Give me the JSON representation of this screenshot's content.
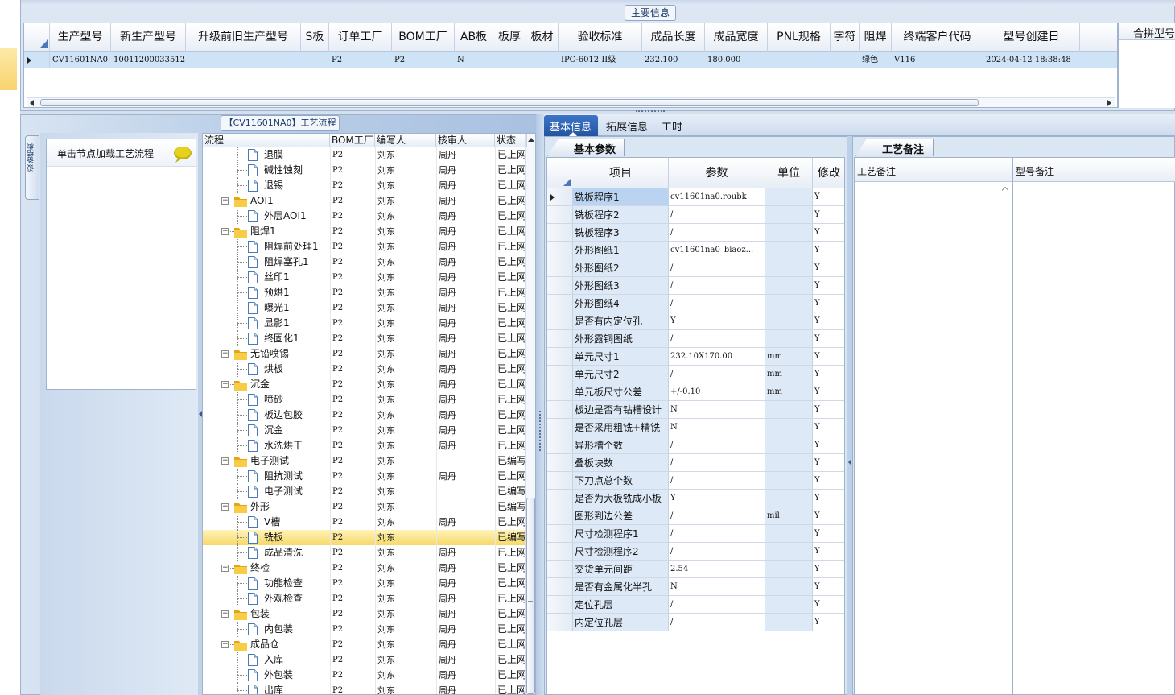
{
  "main_panel_title": "主要信息",
  "main_grid": {
    "columns": [
      "生产型号",
      "新生产型号",
      "升级前旧生产型号",
      "S板",
      "订单工厂",
      "BOM工厂",
      "AB板",
      "板厚",
      "板材",
      "验收标准",
      "成品长度",
      "成品宽度",
      "PNL规格",
      "字符",
      "阻焊",
      "终端客户代码",
      "型号创建日"
    ],
    "row": [
      "CV11601NA0",
      "10011200033512",
      "",
      "",
      "P2",
      "P2",
      "N",
      "",
      "",
      "IPC-6012 II级",
      "232.100",
      "180.000",
      "",
      "",
      "绿色",
      "V116",
      "2024-04-12 18:38:48"
    ]
  },
  "right_panel_title": "合拼型号",
  "flow_panel_title": "【CV11601NA0】工艺流程",
  "side_tab_label": "设备结构",
  "note_text": "单击节点加载工艺流程",
  "tree": {
    "columns": [
      "流程",
      "BOM工厂",
      "编写人",
      "核审人",
      "状态"
    ],
    "rows": [
      {
        "level": 2,
        "type": "file",
        "name": "退膜",
        "bom": "P2",
        "writer": "刘东",
        "reviewer": "周丹",
        "status": "已上网"
      },
      {
        "level": 2,
        "type": "file",
        "name": "碱性蚀刻",
        "bom": "P2",
        "writer": "刘东",
        "reviewer": "周丹",
        "status": "已上网"
      },
      {
        "level": 2,
        "type": "file",
        "name": "退锡",
        "bom": "P2",
        "writer": "刘东",
        "reviewer": "周丹",
        "status": "已上网"
      },
      {
        "level": 1,
        "type": "folder",
        "name": "AOI1",
        "bom": "P2",
        "writer": "刘东",
        "reviewer": "周丹",
        "status": "已上网"
      },
      {
        "level": 2,
        "type": "file",
        "name": "外层AOI1",
        "bom": "P2",
        "writer": "刘东",
        "reviewer": "周丹",
        "status": "已上网"
      },
      {
        "level": 1,
        "type": "folder",
        "name": "阻焊1",
        "bom": "P2",
        "writer": "刘东",
        "reviewer": "周丹",
        "status": "已上网"
      },
      {
        "level": 2,
        "type": "file",
        "name": "阻焊前处理1",
        "bom": "P2",
        "writer": "刘东",
        "reviewer": "周丹",
        "status": "已上网"
      },
      {
        "level": 2,
        "type": "file",
        "name": "阻焊塞孔1",
        "bom": "P2",
        "writer": "刘东",
        "reviewer": "周丹",
        "status": "已上网"
      },
      {
        "level": 2,
        "type": "file",
        "name": "丝印1",
        "bom": "P2",
        "writer": "刘东",
        "reviewer": "周丹",
        "status": "已上网"
      },
      {
        "level": 2,
        "type": "file",
        "name": "预烘1",
        "bom": "P2",
        "writer": "刘东",
        "reviewer": "周丹",
        "status": "已上网"
      },
      {
        "level": 2,
        "type": "file",
        "name": "曝光1",
        "bom": "P2",
        "writer": "刘东",
        "reviewer": "周丹",
        "status": "已上网"
      },
      {
        "level": 2,
        "type": "file",
        "name": "显影1",
        "bom": "P2",
        "writer": "刘东",
        "reviewer": "周丹",
        "status": "已上网"
      },
      {
        "level": 2,
        "type": "file",
        "name": "终固化1",
        "bom": "P2",
        "writer": "刘东",
        "reviewer": "周丹",
        "status": "已上网"
      },
      {
        "level": 1,
        "type": "folder",
        "name": "无铅喷锡",
        "bom": "P2",
        "writer": "刘东",
        "reviewer": "周丹",
        "status": "已上网"
      },
      {
        "level": 2,
        "type": "file",
        "name": "烘板",
        "bom": "P2",
        "writer": "刘东",
        "reviewer": "周丹",
        "status": "已上网"
      },
      {
        "level": 1,
        "type": "folder",
        "name": "沉金",
        "bom": "P2",
        "writer": "刘东",
        "reviewer": "周丹",
        "status": "已上网"
      },
      {
        "level": 2,
        "type": "file",
        "name": "喷砂",
        "bom": "P2",
        "writer": "刘东",
        "reviewer": "周丹",
        "status": "已上网"
      },
      {
        "level": 2,
        "type": "file",
        "name": "板边包胶",
        "bom": "P2",
        "writer": "刘东",
        "reviewer": "周丹",
        "status": "已上网"
      },
      {
        "level": 2,
        "type": "file",
        "name": "沉金",
        "bom": "P2",
        "writer": "刘东",
        "reviewer": "周丹",
        "status": "已上网"
      },
      {
        "level": 2,
        "type": "file",
        "name": "水洗烘干",
        "bom": "P2",
        "writer": "刘东",
        "reviewer": "周丹",
        "status": "已上网"
      },
      {
        "level": 1,
        "type": "folder",
        "name": "电子测试",
        "bom": "P2",
        "writer": "刘东",
        "reviewer": "",
        "status": "已编写"
      },
      {
        "level": 2,
        "type": "file",
        "name": "阻抗测试",
        "bom": "P2",
        "writer": "刘东",
        "reviewer": "周丹",
        "status": "已上网"
      },
      {
        "level": 2,
        "type": "file",
        "name": "电子测试",
        "bom": "P2",
        "writer": "刘东",
        "reviewer": "",
        "status": "已编写"
      },
      {
        "level": 1,
        "type": "folder",
        "name": "外形",
        "bom": "P2",
        "writer": "刘东",
        "reviewer": "",
        "status": "已编写"
      },
      {
        "level": 2,
        "type": "file",
        "name": "V槽",
        "bom": "P2",
        "writer": "刘东",
        "reviewer": "周丹",
        "status": "已上网"
      },
      {
        "level": 2,
        "type": "file",
        "name": "铣板",
        "bom": "P2",
        "writer": "刘东",
        "reviewer": "",
        "status": "已编写",
        "selected": true
      },
      {
        "level": 2,
        "type": "file",
        "name": "成品清洗",
        "bom": "P2",
        "writer": "刘东",
        "reviewer": "周丹",
        "status": "已上网"
      },
      {
        "level": 1,
        "type": "folder",
        "name": "终检",
        "bom": "P2",
        "writer": "刘东",
        "reviewer": "周丹",
        "status": "已上网"
      },
      {
        "level": 2,
        "type": "file",
        "name": "功能检查",
        "bom": "P2",
        "writer": "刘东",
        "reviewer": "周丹",
        "status": "已上网"
      },
      {
        "level": 2,
        "type": "file",
        "name": "外观检查",
        "bom": "P2",
        "writer": "刘东",
        "reviewer": "周丹",
        "status": "已上网"
      },
      {
        "level": 1,
        "type": "folder",
        "name": "包装",
        "bom": "P2",
        "writer": "刘东",
        "reviewer": "周丹",
        "status": "已上网"
      },
      {
        "level": 2,
        "type": "file",
        "name": "内包装",
        "bom": "P2",
        "writer": "刘东",
        "reviewer": "周丹",
        "status": "已上网"
      },
      {
        "level": 1,
        "type": "folder",
        "name": "成品仓",
        "bom": "P2",
        "writer": "刘东",
        "reviewer": "周丹",
        "status": "已上网"
      },
      {
        "level": 2,
        "type": "file",
        "name": "入库",
        "bom": "P2",
        "writer": "刘东",
        "reviewer": "周丹",
        "status": "已上网"
      },
      {
        "level": 2,
        "type": "file",
        "name": "外包装",
        "bom": "P2",
        "writer": "刘东",
        "reviewer": "周丹",
        "status": "已上网"
      },
      {
        "level": 2,
        "type": "file",
        "name": "出库",
        "bom": "P2",
        "writer": "刘东",
        "reviewer": "周丹",
        "status": "已上网"
      }
    ]
  },
  "tabs": [
    "基本信息",
    "拓展信息",
    "工时"
  ],
  "basic_group_title": "基本参数",
  "params": {
    "columns": [
      "项目",
      "参数",
      "单位",
      "修改"
    ],
    "rows": [
      {
        "item": "铣板程序1",
        "value": "cv11601na0.roubk",
        "unit": "",
        "mod": "Y"
      },
      {
        "item": "铣板程序2",
        "value": "/",
        "unit": "",
        "mod": "Y"
      },
      {
        "item": "铣板程序3",
        "value": "/",
        "unit": "",
        "mod": "Y"
      },
      {
        "item": "外形图纸1",
        "value": "cv11601na0_biaoz...",
        "unit": "",
        "mod": "Y"
      },
      {
        "item": "外形图纸2",
        "value": "/",
        "unit": "",
        "mod": "Y"
      },
      {
        "item": "外形图纸3",
        "value": "/",
        "unit": "",
        "mod": "Y"
      },
      {
        "item": "外形图纸4",
        "value": "/",
        "unit": "",
        "mod": "Y"
      },
      {
        "item": "是否有内定位孔",
        "value": "Y",
        "unit": "",
        "mod": "Y"
      },
      {
        "item": "外形露铜图纸",
        "value": "/",
        "unit": "",
        "mod": "Y"
      },
      {
        "item": "单元尺寸1",
        "value": "232.10X170.00",
        "unit": "mm",
        "mod": "Y"
      },
      {
        "item": "单元尺寸2",
        "value": "/",
        "unit": "mm",
        "mod": "Y"
      },
      {
        "item": "单元板尺寸公差",
        "value": "+/-0.10",
        "unit": "mm",
        "mod": "Y"
      },
      {
        "item": "板边是否有钻槽设计",
        "value": "N",
        "unit": "",
        "mod": "Y"
      },
      {
        "item": "是否采用粗铣+精铣",
        "value": "N",
        "unit": "",
        "mod": "Y"
      },
      {
        "item": "异形槽个数",
        "value": "/",
        "unit": "",
        "mod": "Y"
      },
      {
        "item": "叠板块数",
        "value": "/",
        "unit": "",
        "mod": "Y"
      },
      {
        "item": "下刀点总个数",
        "value": "/",
        "unit": "",
        "mod": "Y"
      },
      {
        "item": "是否为大板铣成小板",
        "value": "Y",
        "unit": "",
        "mod": "Y"
      },
      {
        "item": "图形到边公差",
        "value": "/",
        "unit": "mil",
        "mod": "Y"
      },
      {
        "item": "尺寸检测程序1",
        "value": "/",
        "unit": "",
        "mod": "Y"
      },
      {
        "item": "尺寸检测程序2",
        "value": "/",
        "unit": "",
        "mod": "Y"
      },
      {
        "item": "交货单元间距",
        "value": "2.54",
        "unit": "",
        "mod": "Y"
      },
      {
        "item": "是否有金属化半孔",
        "value": "N",
        "unit": "",
        "mod": "Y"
      },
      {
        "item": "定位孔层",
        "value": "/",
        "unit": "",
        "mod": "Y"
      },
      {
        "item": "内定位孔层",
        "value": "/",
        "unit": "",
        "mod": "Y"
      }
    ]
  },
  "remark_group_title": "工艺备注",
  "remark_columns": [
    "工艺备注",
    "型号备注"
  ]
}
